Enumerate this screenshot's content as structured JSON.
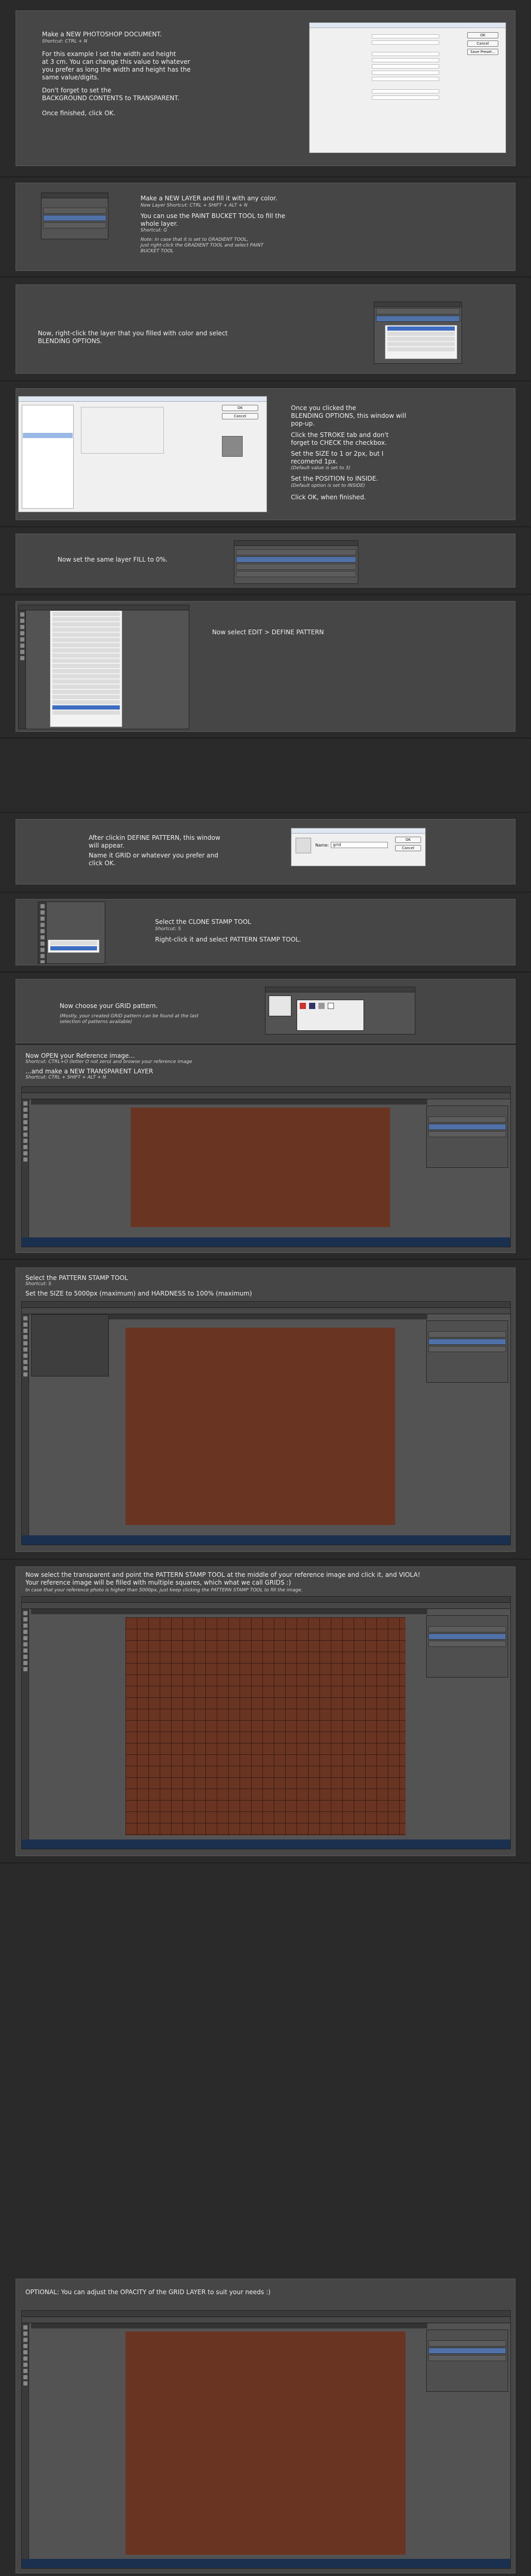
{
  "steps": {
    "s1": {
      "title": "Make a NEW PHOTOSHOP DOCUMENT.",
      "shortcut": "Shortcut: CTRL + N",
      "body": "For this example I set the width and height\nat 3 cm. You can change this value to whatever\nyou prefer as long the width and height has the\nsame value/digits.",
      "note": "Don't forget to set the\nBACKGROUND CONTENTS to TRANSPARENT.",
      "end": "Once finished, click OK."
    },
    "s2": {
      "title": "Make a NEW LAYER and fill it with any color.",
      "shortcut": "New Layer Shortcut: CTRL + SHIFT + ALT + N",
      "body": "You can use the PAINT BUCKET TOOL to fill the\nwhole layer.",
      "shortcut2": "Shortcut: G",
      "note": "Note: In case that it is set to GRADIENT TOOL,\njust right-click the GRADIENT TOOL and select PAINT\nBUCKET TOOL"
    },
    "s3": {
      "body": "Now, right-click the layer that you filled with color and select\nBLENDING OPTIONS."
    },
    "s4": {
      "body": "Once you clicked the\nBLENDING OPTIONS, this window will\npop-up.",
      "stroke": "Click the STROKE tab and don't\nforget to CHECK the checkbox.",
      "size": "Set the SIZE to 1 or 2px, but I\nrecomend 1px.",
      "size_note": "(Default value is set to 3)",
      "pos": "Set the POSITION to INSIDE.",
      "pos_note": "(Default option is set to INSIDE)",
      "end": "Click OK, when finished."
    },
    "s5": {
      "body": "Now set the same layer FILL to 0%."
    },
    "s6": {
      "body": "Now select EDIT > DEFINE PATTERN"
    },
    "s7": {
      "body": "After clickin DEFINE PATTERN, this window\nwill appear.",
      "end": "Name it GRID or whatever you prefer and\nclick OK."
    },
    "s8": {
      "title": "Select the CLONE STAMP TOOL",
      "shortcut": "Shortcut: S",
      "body": "Right-click it  and select PATTERN STAMP TOOL."
    },
    "s9": {
      "body": "Now choose your GRID pattern.",
      "note": "(Mostly, your created GRID pattern can be found at the last\nselection of patterns available)"
    },
    "s10": {
      "title": "Now OPEN your Reference image...",
      "shortcut": "Shortcut: CTRL+O (letter O not zero) and browse your reference image",
      "body": "...and make a NEW TRANSPARENT LAYER",
      "shortcut2": "Shortcut: CTRL + SHIFT + ALT + N"
    },
    "s11": {
      "title": "Select the PATTERN STAMP TOOL",
      "shortcut": "Shortcut: S",
      "body": "Set the SIZE to 5000px (maximum) and HARDNESS to 100% (maximum)"
    },
    "s12": {
      "body": "Now select the transparent and point the PATTERN STAMP TOOL at the middle of your reference image and click it, and VIOLA!\nYour reference image will be filled with multiple squares, which what we call GRIDS :)",
      "note": "In case that your reference photo is higher than 5000px, just keep clicking the PATTERN STAMP TOOL to fill the image."
    },
    "s13": {
      "body": "OPTIONAL: You can adjust the OPACITY of the GRID LAYER to suit your needs :)"
    }
  },
  "dialogs": {
    "new_doc": {
      "ok": "OK",
      "cancel": "Cancel",
      "save": "Save Preset..."
    },
    "pattern": {
      "name_label": "Name:",
      "name_value": "grid",
      "ok": "OK",
      "cancel": "Cancel"
    },
    "layer_style": {
      "ok": "OK",
      "cancel": "Cancel"
    },
    "context": {
      "blending": "Blending Options..."
    }
  },
  "colors": {
    "panel": "#464646",
    "background": "#2a2a2a",
    "text": "#f1f1f1",
    "accent": "#3d6cc1"
  }
}
